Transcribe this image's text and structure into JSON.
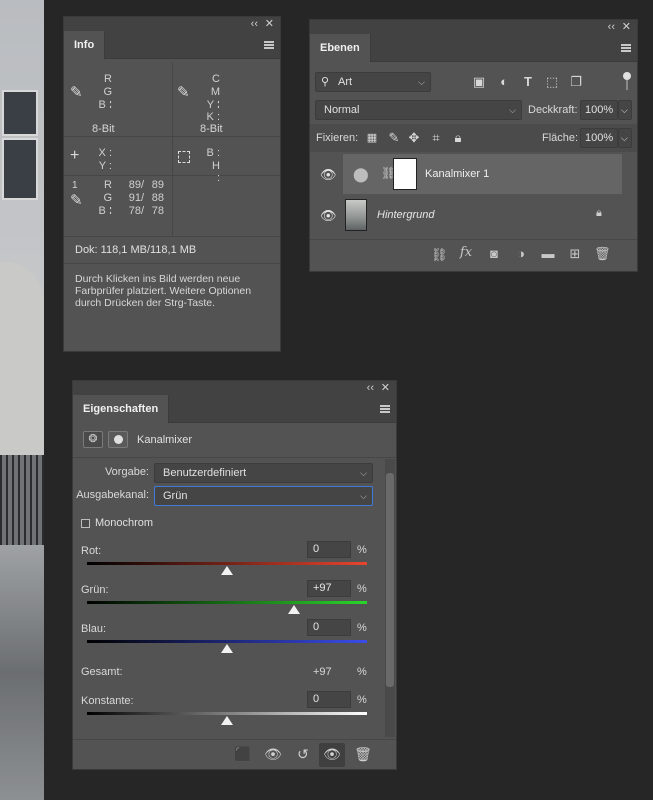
{
  "info": {
    "tab": "Info",
    "rgb_labels": [
      "R :",
      "G :",
      "B :"
    ],
    "cmyk_labels": [
      "C :",
      "M :",
      "Y :",
      "K :"
    ],
    "bit_left": "8-Bit",
    "bit_right": "8-Bit",
    "xy_labels": [
      "X :",
      "Y :"
    ],
    "bh_labels": [
      "B :",
      "H :"
    ],
    "sampler_index": "1",
    "sampler_labels": [
      "R :",
      "G :",
      "B :"
    ],
    "sampler_values": [
      [
        "89/",
        "89"
      ],
      [
        "91/",
        "88"
      ],
      [
        "78/",
        "78"
      ]
    ],
    "doc": "Dok: 118,1 MB/118,1 MB",
    "hint": "Durch Klicken ins Bild werden neue Farbprüfer platziert. Weitere Optionen durch Drücken der Strg-Taste."
  },
  "layers": {
    "tab": "Ebenen",
    "filter_value": "Art",
    "blend_mode": "Normal",
    "opacity_label": "Deckkraft:",
    "opacity_value": "100%",
    "lock_label": "Fixieren:",
    "fill_label": "Fläche:",
    "fill_value": "100%",
    "items": [
      {
        "name": "Kanalmixer 1"
      },
      {
        "name": "Hintergrund"
      }
    ]
  },
  "props": {
    "tab": "Eigenschaften",
    "adjustment_name": "Kanalmixer",
    "preset_label": "Vorgabe:",
    "preset_value": "Benutzerdefiniert",
    "channel_label": "Ausgabekanal:",
    "channel_value": "Grün",
    "monochrome_label": "Monochrom",
    "monochrome_checked": false,
    "sliders": [
      {
        "label": "Rot:",
        "value": "0",
        "fraction": 0.5,
        "color": "#e8452f"
      },
      {
        "label": "Grün:",
        "value": "+97",
        "fraction": 0.74,
        "color": "#2ad62a"
      },
      {
        "label": "Blau:",
        "value": "0",
        "fraction": 0.5,
        "color": "#3b4de8"
      }
    ],
    "total_label": "Gesamt:",
    "total_value": "+97",
    "constant_label": "Konstante:",
    "constant_value": "0",
    "constant_fraction": 0.5,
    "pct": "%"
  }
}
